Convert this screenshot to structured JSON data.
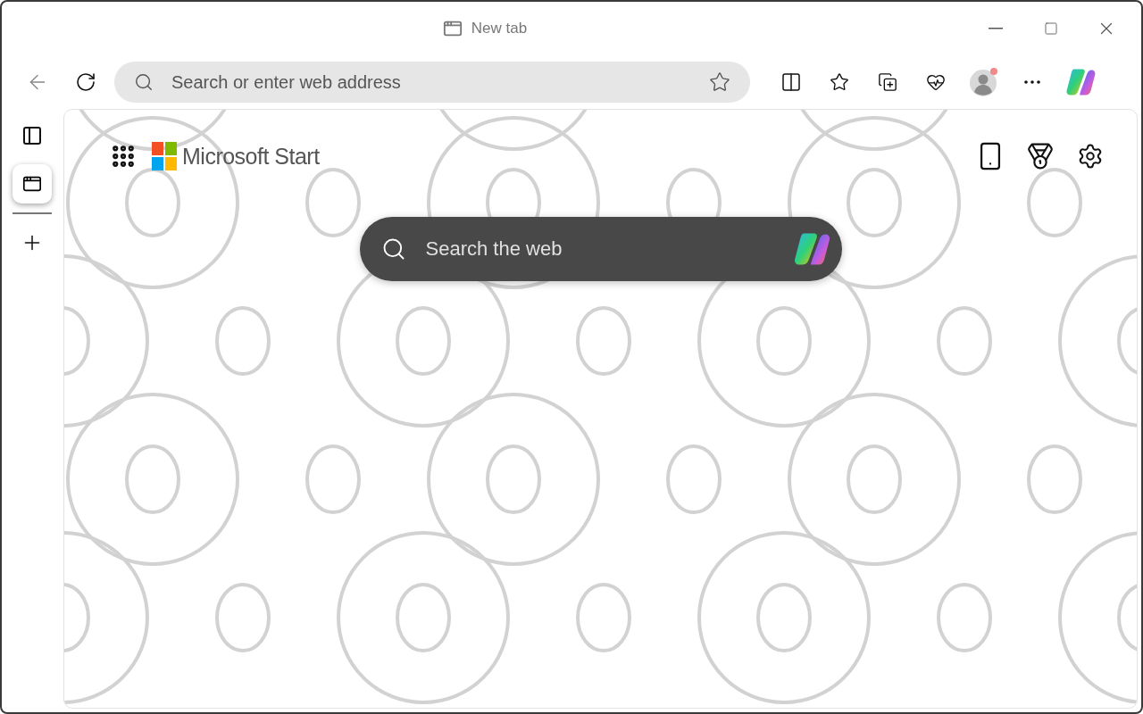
{
  "window": {
    "title": "New tab"
  },
  "address_bar": {
    "placeholder": "Search or enter web address"
  },
  "vertical_tabs": [
    {
      "selected": true
    }
  ],
  "page": {
    "brand": "Microsoft Start",
    "search": {
      "placeholder": "Search the web"
    }
  }
}
